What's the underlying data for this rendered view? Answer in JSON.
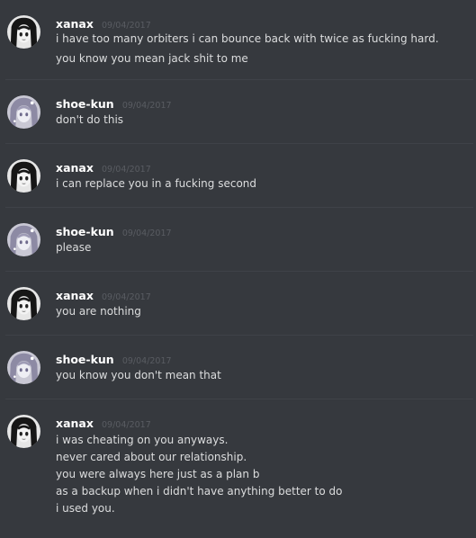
{
  "messages": [
    {
      "author": "xanax",
      "timestamp": "09/04/2017",
      "avatar": "monochrome-anime-girl-avatar",
      "lines": [
        "i have too many orbiters i can bounce back with twice as fucking hard.",
        "you know you mean jack shit to me"
      ]
    },
    {
      "author": "shoe-kun",
      "timestamp": "09/04/2017",
      "avatar": "pale-anime-girl-avatar",
      "lines": [
        "don't do this"
      ]
    },
    {
      "author": "xanax",
      "timestamp": "09/04/2017",
      "avatar": "monochrome-anime-girl-avatar",
      "lines": [
        "i can replace you in a fucking second"
      ]
    },
    {
      "author": "shoe-kun",
      "timestamp": "09/04/2017",
      "avatar": "pale-anime-girl-avatar",
      "lines": [
        "please"
      ]
    },
    {
      "author": "xanax",
      "timestamp": "09/04/2017",
      "avatar": "monochrome-anime-girl-avatar",
      "lines": [
        "you are nothing"
      ]
    },
    {
      "author": "shoe-kun",
      "timestamp": "09/04/2017",
      "avatar": "pale-anime-girl-avatar",
      "lines": [
        "you know you don't mean that"
      ]
    },
    {
      "author": "xanax",
      "timestamp": "09/04/2017",
      "avatar": "monochrome-anime-girl-avatar",
      "lines": [
        "i was cheating on you anyways.",
        "never cared about our relationship.",
        "you were always here just as a plan b",
        "as a backup when i didn't have anything better to do",
        "i used you."
      ]
    }
  ],
  "colors": {
    "background": "#36393e",
    "username": "#ffffff",
    "timestamp": "#595c62",
    "message_text": "#dcddde",
    "divider": "#3f4248"
  }
}
